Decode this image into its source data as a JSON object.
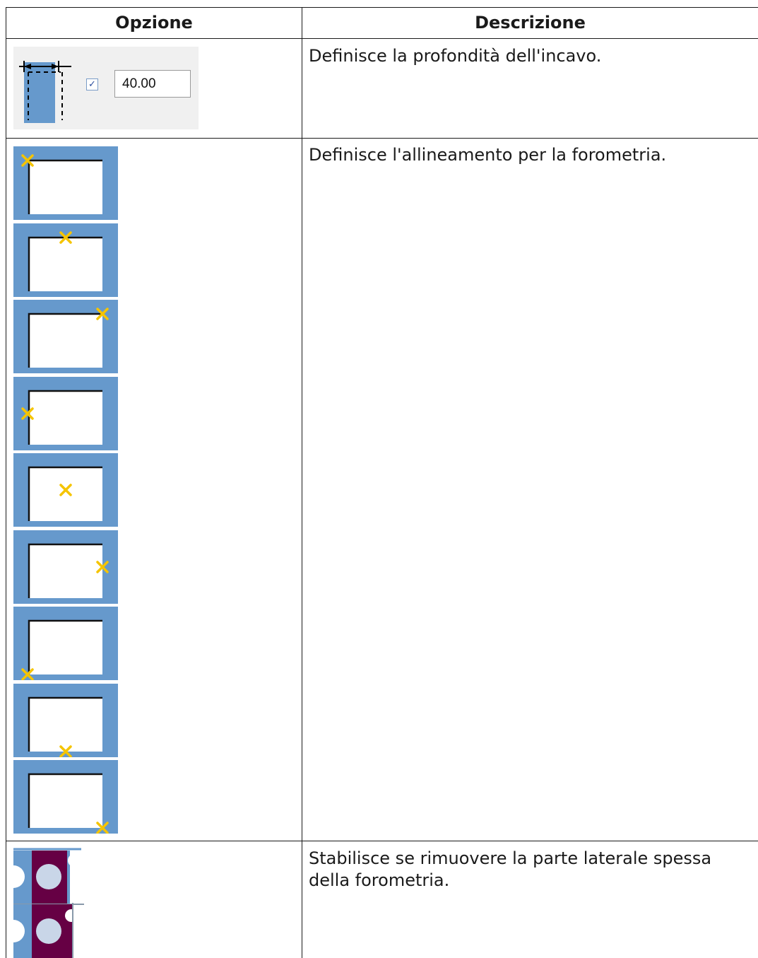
{
  "table": {
    "headers": {
      "option": "Opzione",
      "description": "Descrizione"
    },
    "rows": [
      {
        "description": "Definisce la profondità dell'incavo.",
        "control": {
          "checkbox_checked": true,
          "value": "40.00"
        },
        "icon": "recess-depth-icon"
      },
      {
        "description": "Definisce l'allineamento per la forometria.",
        "icons": [
          "align-top-left-icon",
          "align-top-center-icon",
          "align-top-right-icon",
          "align-middle-left-icon",
          "align-middle-center-icon",
          "align-middle-right-icon",
          "align-bottom-left-icon",
          "align-bottom-center-icon",
          "align-bottom-right-icon"
        ]
      },
      {
        "description": "Stabilisce se rimuovere la parte laterale spessa\ndella forometria.",
        "icons": [
          "keep-thick-side-icon",
          "remove-thick-side-icon"
        ]
      }
    ]
  },
  "colors": {
    "panel_blue": "#6699cc",
    "marker_yellow": "#f5c400",
    "profile_purple": "#660044"
  }
}
